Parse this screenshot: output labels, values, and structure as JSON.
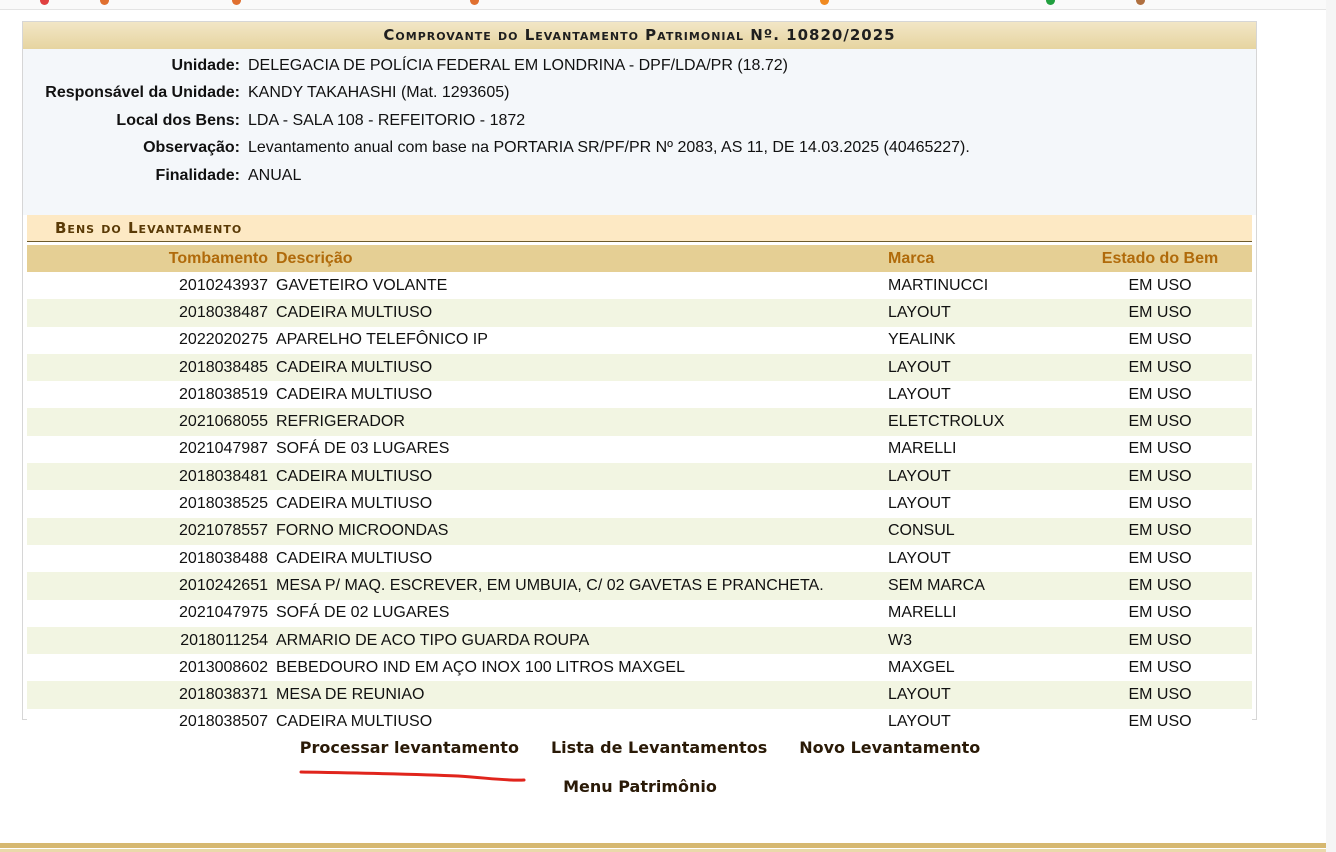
{
  "caption": "Comprovante do Levantamento Patrimonial Nº. 10820/2025",
  "info": [
    {
      "label": "Unidade:",
      "value": "DELEGACIA DE POLÍCIA FEDERAL EM LONDRINA - DPF/LDA/PR (18.72)"
    },
    {
      "label": "Responsável da Unidade:",
      "value": "KANDY TAKAHASHI (Mat. 1293605)"
    },
    {
      "label": "Local dos Bens:",
      "value": "LDA - SALA 108 - REFEITORIO - 1872"
    },
    {
      "label": "Observação:",
      "value": "Levantamento anual com base na PORTARIA SR/PF/PR Nº 2083, AS 11, DE 14.03.2025 (40465227)."
    },
    {
      "label": "Finalidade:",
      "value": "ANUAL"
    }
  ],
  "bens_caption": "Bens do Levantamento",
  "table": {
    "headers": {
      "tombamento": "Tombamento",
      "descricao": "Descrição",
      "marca": "Marca",
      "estado": "Estado do Bem"
    },
    "rows": [
      {
        "tombamento": "2010243937",
        "descricao": "GAVETEIRO VOLANTE",
        "marca": "MARTINUCCI",
        "estado": "EM USO"
      },
      {
        "tombamento": "2018038487",
        "descricao": "CADEIRA MULTIUSO",
        "marca": "LAYOUT",
        "estado": "EM USO"
      },
      {
        "tombamento": "2022020275",
        "descricao": "APARELHO TELEFÔNICO IP",
        "marca": "YEALINK",
        "estado": "EM USO"
      },
      {
        "tombamento": "2018038485",
        "descricao": "CADEIRA MULTIUSO",
        "marca": "LAYOUT",
        "estado": "EM USO"
      },
      {
        "tombamento": "2018038519",
        "descricao": "CADEIRA MULTIUSO",
        "marca": "LAYOUT",
        "estado": "EM USO"
      },
      {
        "tombamento": "2021068055",
        "descricao": "REFRIGERADOR",
        "marca": "ELETCTROLUX",
        "estado": "EM USO"
      },
      {
        "tombamento": "2021047987",
        "descricao": "SOFÁ DE 03 LUGARES",
        "marca": "MARELLI",
        "estado": "EM USO"
      },
      {
        "tombamento": "2018038481",
        "descricao": "CADEIRA MULTIUSO",
        "marca": "LAYOUT",
        "estado": "EM USO"
      },
      {
        "tombamento": "2018038525",
        "descricao": "CADEIRA MULTIUSO",
        "marca": "LAYOUT",
        "estado": "EM USO"
      },
      {
        "tombamento": "2021078557",
        "descricao": "FORNO MICROONDAS",
        "marca": "CONSUL",
        "estado": "EM USO"
      },
      {
        "tombamento": "2018038488",
        "descricao": "CADEIRA MULTIUSO",
        "marca": "LAYOUT",
        "estado": "EM USO"
      },
      {
        "tombamento": "2010242651",
        "descricao": "MESA P/ MAQ. ESCREVER, EM UMBUIA, C/ 02 GAVETAS E PRANCHETA.",
        "marca": "SEM MARCA",
        "estado": "EM USO"
      },
      {
        "tombamento": "2021047975",
        "descricao": "SOFÁ DE 02 LUGARES",
        "marca": "MARELLI",
        "estado": "EM USO"
      },
      {
        "tombamento": "2018011254",
        "descricao": "ARMARIO DE ACO TIPO GUARDA ROUPA",
        "marca": "W3",
        "estado": "EM USO"
      },
      {
        "tombamento": "2013008602",
        "descricao": "BEBEDOURO IND EM AÇO INOX 100 LITROS MAXGEL",
        "marca": "MAXGEL",
        "estado": "EM USO"
      },
      {
        "tombamento": "2018038371",
        "descricao": "MESA DE REUNIAO",
        "marca": "LAYOUT",
        "estado": "EM USO"
      },
      {
        "tombamento": "2018038507",
        "descricao": "CADEIRA MULTIUSO",
        "marca": "LAYOUT",
        "estado": "EM USO"
      }
    ]
  },
  "actions": {
    "processar": "Processar levantamento",
    "lista": "Lista de Levantamentos",
    "novo": "Novo Levantamento",
    "menu": "Menu Patrimônio"
  },
  "colors": {
    "caption_bg": "#e6d4a0",
    "header_bg": "#e5cf94",
    "header_text": "#b06a0a",
    "row_alt_bg": "#f2f5e2",
    "annotation_red": "#e0241c"
  }
}
